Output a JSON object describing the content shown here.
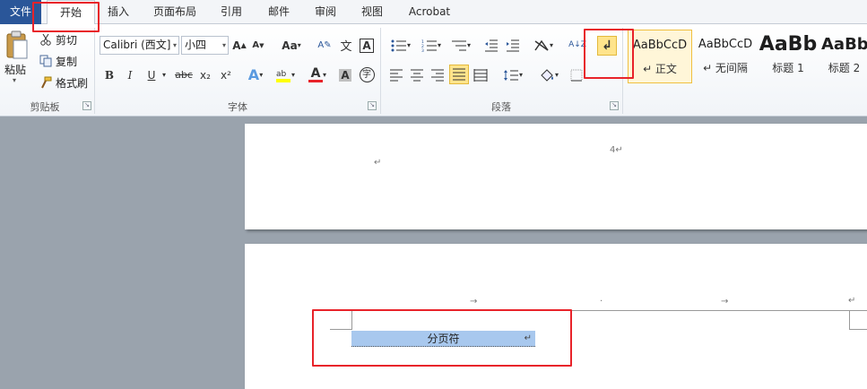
{
  "tabs": {
    "file": "文件",
    "home": "开始",
    "insert": "插入",
    "layout": "页面布局",
    "references": "引用",
    "mailings": "邮件",
    "review": "审阅",
    "view": "视图",
    "acrobat": "Acrobat"
  },
  "clipboard": {
    "paste": "粘贴",
    "cut": "剪切",
    "copy": "复制",
    "format_painter": "格式刷",
    "group_label": "剪贴板"
  },
  "font": {
    "family": "Calibri (西文]",
    "size": "小四",
    "change_case": "Aa",
    "bold": "B",
    "italic": "I",
    "underline": "U",
    "strikethrough": "abc",
    "subscript": "x₂",
    "superscript": "x²",
    "text_effect": "A",
    "font_color": "A",
    "char_shading": "A",
    "enclose": "字",
    "group_label": "字体"
  },
  "paragraph": {
    "group_label": "段落",
    "sort_glyph": "A↓Z",
    "show_marks_glyph": "↲"
  },
  "styles": {
    "items": [
      {
        "preview": "AaBbCcD",
        "name": "↵ 正文"
      },
      {
        "preview": "AaBbCcD",
        "name": "↵ 无间隔"
      },
      {
        "preview": "AaBb",
        "name": "标题 1"
      },
      {
        "preview": "AaBb",
        "name": "标题 2"
      }
    ]
  },
  "document": {
    "page_number": "4↵",
    "para_mark": "↵",
    "tab_arrow": "→",
    "center_dot": "·",
    "page_break_label": "分页符",
    "page_break_mark": "↵"
  },
  "colors": {
    "file_tab": "#2a5699",
    "highlight_red": "#e8232a",
    "selection": "#a8c8ee",
    "active_toggle": "#ffe48c"
  }
}
